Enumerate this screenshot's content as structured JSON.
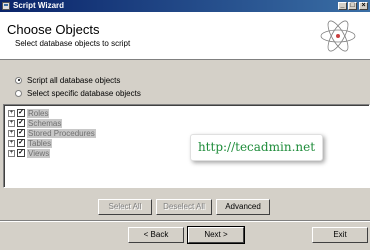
{
  "window": {
    "title": "Script Wizard",
    "minimize_label": "_",
    "maximize_label": "□",
    "close_label": "×"
  },
  "header": {
    "title": "Choose Objects",
    "subtitle": "Select database objects to script"
  },
  "options": {
    "script_all": {
      "label": "Script all database objects",
      "selected": true
    },
    "script_specific": {
      "label": "Select specific database objects",
      "selected": false
    }
  },
  "tree": {
    "items": [
      {
        "expander": "+",
        "checked": "✓",
        "label": "Roles"
      },
      {
        "expander": "+",
        "checked": "✓",
        "label": "Schemas"
      },
      {
        "expander": "+",
        "checked": "✓",
        "label": "Stored Procedures"
      },
      {
        "expander": "+",
        "checked": "✓",
        "label": "Tables"
      },
      {
        "expander": "+",
        "checked": "✓",
        "label": "Views"
      }
    ]
  },
  "watermark": {
    "text": "http://tecadmin.net"
  },
  "selection_buttons": {
    "select_all": "Select All",
    "deselect_all": "Deselect All",
    "advanced": "Advanced"
  },
  "nav_buttons": {
    "back": "< Back",
    "next": "Next >",
    "exit": "Exit"
  },
  "colors": {
    "titlebar_start": "#0a246a",
    "titlebar_end": "#3a6ea5",
    "watermark_text": "#1e8c3a"
  }
}
